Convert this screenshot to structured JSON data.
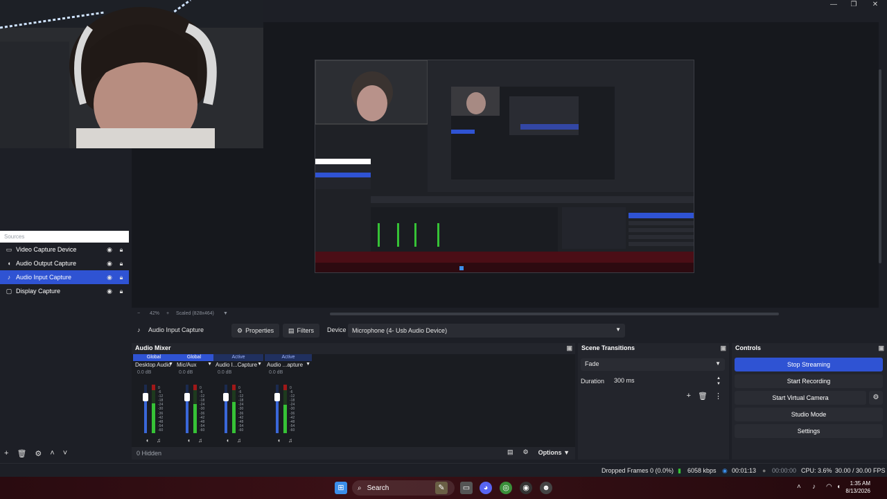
{
  "window": {
    "controls": [
      "—",
      "❐",
      "✕"
    ]
  },
  "preview": {
    "zoom_text": "42%",
    "scale_mode": "Scaled (828x464)"
  },
  "sources": {
    "title": "Sources",
    "items": [
      {
        "label": "Video Capture Device",
        "icon": "camera-icon",
        "selected": false
      },
      {
        "label": "Audio Output Capture",
        "icon": "speaker-icon",
        "selected": false
      },
      {
        "label": "Audio Input Capture",
        "icon": "microphone-icon",
        "selected": true
      },
      {
        "label": "Display Capture",
        "icon": "monitor-icon",
        "selected": false
      }
    ]
  },
  "context_bar": {
    "source_name": "Audio Input Capture",
    "properties_label": "Properties",
    "filters_label": "Filters",
    "device_label": "Device",
    "device_value": "Microphone (4- Usb Audio Device)"
  },
  "mixer": {
    "title": "Audio Mixer",
    "channels": [
      {
        "status": "Global",
        "name": "Desktop Audio",
        "db": "0.0 dB",
        "level": 0.72
      },
      {
        "status": "Global",
        "name": "Mic/Aux",
        "db": "0.0 dB",
        "level": 0.7
      },
      {
        "status": "Active",
        "name": "Audio I...Capture",
        "db": "0.0 dB",
        "level": 0.74
      },
      {
        "status": "Active",
        "name": "Audio ...apture",
        "db": "0.0 dB",
        "level": 0.68
      }
    ],
    "scale": [
      "0",
      "-6",
      "-12",
      "-18",
      "-24",
      "-30",
      "-36",
      "-42",
      "-48",
      "-54",
      "-60"
    ],
    "hidden_text": "0 Hidden",
    "options_label": "Options"
  },
  "transitions": {
    "title": "Scene Transitions",
    "selected": "Fade",
    "duration_label": "Duration",
    "duration_value": "300 ms"
  },
  "controls": {
    "title": "Controls",
    "stop_streaming": "Stop Streaming",
    "start_recording": "Start Recording",
    "start_virtual_camera": "Start Virtual Camera",
    "studio_mode": "Studio Mode",
    "settings": "Settings"
  },
  "status": {
    "dropped_frames": "Dropped Frames 0 (0.0%)",
    "bitrate": "6058 kbps",
    "stream_time": "00:01:13",
    "record_time": "00:00:00",
    "cpu": "CPU: 3.6%",
    "fps": "30.00 / 30.00 FPS"
  },
  "taskbar": {
    "search_label": "Search",
    "time": "1:35 AM",
    "date": "8/13/2026"
  },
  "colors": {
    "accent": "#2f53d3",
    "panel": "#23252c",
    "background": "#1d1f26"
  }
}
